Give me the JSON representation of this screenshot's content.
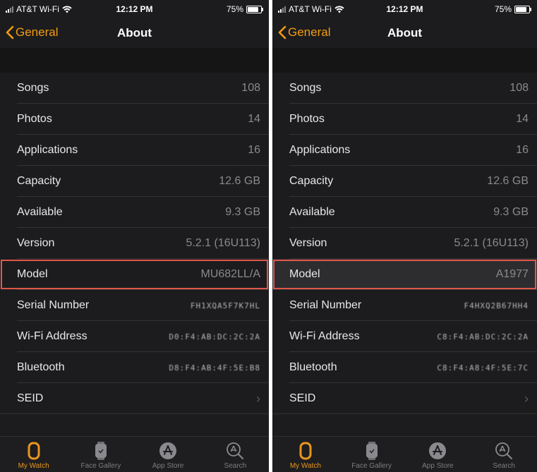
{
  "screens": [
    {
      "status": {
        "carrier": "AT&T Wi-Fi",
        "time": "12:12 PM",
        "battery": "75%",
        "battery_level": 0.75
      },
      "nav": {
        "back_label": "General",
        "title": "About"
      },
      "rows": [
        {
          "label": "Songs",
          "value": "108"
        },
        {
          "label": "Photos",
          "value": "14"
        },
        {
          "label": "Applications",
          "value": "16"
        },
        {
          "label": "Capacity",
          "value": "12.6 GB"
        },
        {
          "label": "Available",
          "value": "9.3 GB"
        },
        {
          "label": "Version",
          "value": "5.2.1 (16U113)"
        },
        {
          "label": "Model",
          "value": "MU682LL/A"
        },
        {
          "label": "Serial Number",
          "value": "FH1XQA5F7K7HL"
        },
        {
          "label": "Wi-Fi Address",
          "value": "D0:F4:AB:DC:2C:2A"
        },
        {
          "label": "Bluetooth",
          "value": "D8:F4:AB:4F:5E:B8"
        },
        {
          "label": "SEID",
          "value": "›"
        }
      ]
    },
    {
      "status": {
        "carrier": "AT&T Wi-Fi",
        "time": "12:12 PM",
        "battery": "75%",
        "battery_level": 0.75
      },
      "nav": {
        "back_label": "General",
        "title": "About"
      },
      "rows": [
        {
          "label": "Songs",
          "value": "108"
        },
        {
          "label": "Photos",
          "value": "14"
        },
        {
          "label": "Applications",
          "value": "16"
        },
        {
          "label": "Capacity",
          "value": "12.6 GB"
        },
        {
          "label": "Available",
          "value": "9.3 GB"
        },
        {
          "label": "Version",
          "value": "5.2.1 (16U113)"
        },
        {
          "label": "Model",
          "value": "A1977"
        },
        {
          "label": "Serial Number",
          "value": "F4HXQ2B67HH4"
        },
        {
          "label": "Wi-Fi Address",
          "value": "C8:F4:AB:DC:2C:2A"
        },
        {
          "label": "Bluetooth",
          "value": "C8:F4:A8:4F:5E:7C"
        },
        {
          "label": "SEID",
          "value": "›"
        }
      ]
    }
  ],
  "tabbar": {
    "tabs": [
      {
        "label": "My Watch",
        "icon": "watch-icon",
        "active": true
      },
      {
        "label": "Face Gallery",
        "icon": "face-gallery-icon",
        "active": false
      },
      {
        "label": "App Store",
        "icon": "app-store-icon",
        "active": false
      },
      {
        "label": "Search",
        "icon": "search-icon",
        "active": false
      }
    ]
  },
  "colors": {
    "accent": "#f39c12",
    "highlight_border": "#e0584a",
    "background": "#1c1c1e"
  }
}
